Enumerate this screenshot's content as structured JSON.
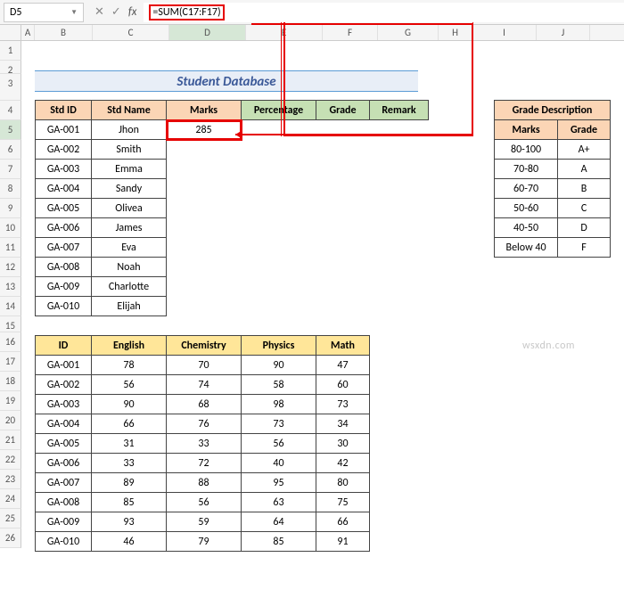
{
  "formula_bar": {
    "cell_ref": "D5",
    "formula": "=SUM(C17:F17)"
  },
  "title": "Student Database",
  "columns": [
    "A",
    "B",
    "C",
    "D",
    "E",
    "F",
    "G",
    "H",
    "I",
    "J"
  ],
  "selected_col": "D",
  "selected_row": 5,
  "student_db": {
    "headers": [
      "Std ID",
      "Std Name",
      "Marks",
      "Percentage",
      "Grade",
      "Remark"
    ],
    "rows": [
      {
        "id": "GA-001",
        "name": "Jhon",
        "marks": "285"
      },
      {
        "id": "GA-002",
        "name": "Smith",
        "marks": ""
      },
      {
        "id": "GA-003",
        "name": "Emma",
        "marks": ""
      },
      {
        "id": "GA-004",
        "name": "Sandy",
        "marks": ""
      },
      {
        "id": "GA-005",
        "name": "Olivea",
        "marks": ""
      },
      {
        "id": "GA-006",
        "name": "James",
        "marks": ""
      },
      {
        "id": "GA-007",
        "name": "Eva",
        "marks": ""
      },
      {
        "id": "GA-008",
        "name": "Noah",
        "marks": ""
      },
      {
        "id": "GA-009",
        "name": "Charlotte",
        "marks": ""
      },
      {
        "id": "GA-010",
        "name": "Elijah",
        "marks": ""
      }
    ]
  },
  "grade_desc": {
    "title": "Grade Description",
    "headers": [
      "Marks",
      "Grade"
    ],
    "rows": [
      {
        "m": "80-100",
        "g": "A+"
      },
      {
        "m": "70-80",
        "g": "A"
      },
      {
        "m": "60-70",
        "g": "B"
      },
      {
        "m": "50-60",
        "g": "C"
      },
      {
        "m": "40-50",
        "g": "D"
      },
      {
        "m": "Below 40",
        "g": "F"
      }
    ]
  },
  "scores": {
    "headers": [
      "ID",
      "English",
      "Chemistry",
      "Physics",
      "Math"
    ],
    "rows": [
      {
        "id": "GA-001",
        "en": "78",
        "ch": "70",
        "ph": "90",
        "ma": "47"
      },
      {
        "id": "GA-002",
        "en": "56",
        "ch": "74",
        "ph": "58",
        "ma": "60"
      },
      {
        "id": "GA-003",
        "en": "90",
        "ch": "68",
        "ph": "98",
        "ma": "73"
      },
      {
        "id": "GA-004",
        "en": "66",
        "ch": "76",
        "ph": "73",
        "ma": "34"
      },
      {
        "id": "GA-005",
        "en": "31",
        "ch": "33",
        "ph": "56",
        "ma": "30"
      },
      {
        "id": "GA-006",
        "en": "33",
        "ch": "72",
        "ph": "40",
        "ma": "42"
      },
      {
        "id": "GA-007",
        "en": "89",
        "ch": "88",
        "ph": "95",
        "ma": "80"
      },
      {
        "id": "GA-008",
        "en": "85",
        "ch": "56",
        "ph": "63",
        "ma": "75"
      },
      {
        "id": "GA-009",
        "en": "93",
        "ch": "59",
        "ph": "64",
        "ma": "66"
      },
      {
        "id": "GA-010",
        "en": "46",
        "ch": "79",
        "ph": "85",
        "ma": "91"
      }
    ]
  },
  "watermark": "wsxdn.com",
  "row_count": 26
}
